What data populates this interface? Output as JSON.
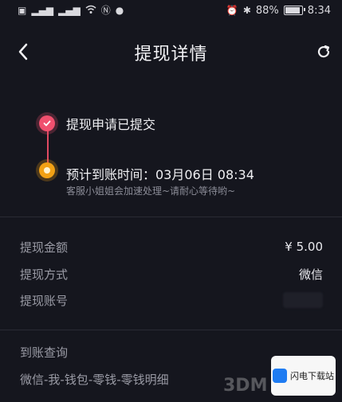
{
  "status_bar": {
    "battery": "88%",
    "time": "8:34"
  },
  "header": {
    "title": "提现详情"
  },
  "timeline": {
    "step1_label": "提现申请已提交",
    "step2_label": "预计到账时间：03月06日 08:34",
    "step2_note": "客服小姐姐会加速处理~请耐心等待哟~"
  },
  "details": {
    "amount_label": "提现金额",
    "amount_value": "¥ 5.00",
    "method_label": "提现方式",
    "method_value": "微信",
    "account_label": "提现账号"
  },
  "query": {
    "title": "到账查询",
    "path": "微信-我-钱包-零钱-零钱明细"
  },
  "watermark": {
    "text": "3DM",
    "badge_text": "闪电下载站"
  },
  "colors": {
    "background": "#15161e",
    "done_dot": "#f0506e",
    "pending_dot": "#f2a115"
  }
}
